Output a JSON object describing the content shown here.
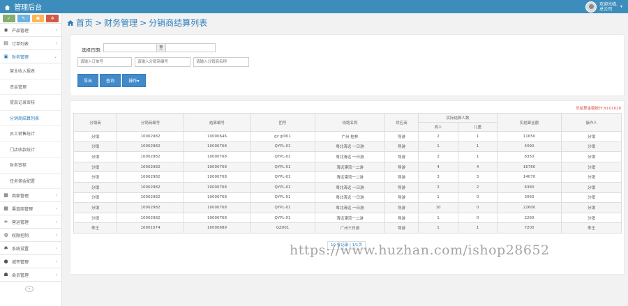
{
  "app": {
    "title": "管理后台"
  },
  "user": {
    "line1": "欢迎光临,",
    "line2": "总公司",
    "caret": "▾"
  },
  "quick_buttons": [
    {
      "icon": "leaf-icon",
      "glyph": "✓"
    },
    {
      "icon": "pencil-icon",
      "glyph": "✎"
    },
    {
      "icon": "users-icon",
      "glyph": "☗"
    },
    {
      "icon": "cogs-icon",
      "glyph": "✲"
    }
  ],
  "sidebar": {
    "top_items": [
      {
        "label": "产品管理",
        "icon": "product-icon",
        "glyph": "◉"
      },
      {
        "label": "订单列表",
        "icon": "order-icon",
        "glyph": "▤"
      },
      {
        "label": "财务管理",
        "icon": "finance-icon",
        "glyph": "▣"
      }
    ],
    "sub_items": [
      {
        "label": "营业收入报表"
      },
      {
        "label": "资金管理"
      },
      {
        "label": "提现记录审核"
      },
      {
        "label": "分销商结算列表"
      },
      {
        "label": "员工销售统计"
      },
      {
        "label": "门店收款统计"
      },
      {
        "label": "财务审核"
      },
      {
        "label": "任务佣金配置"
      }
    ],
    "bottom_items": [
      {
        "label": "商家管理",
        "icon": "store-icon",
        "glyph": "▦"
      },
      {
        "label": "渠道商管理",
        "icon": "channel-icon",
        "glyph": "▦"
      },
      {
        "label": "营运管理",
        "icon": "sliders-icon",
        "glyph": "≑"
      },
      {
        "label": "权限控制",
        "icon": "lock-icon",
        "glyph": "◍"
      },
      {
        "label": "系统设置",
        "icon": "gear-icon",
        "glyph": "✱"
      },
      {
        "label": "城市管理",
        "icon": "map-marker-icon",
        "glyph": "●"
      },
      {
        "label": "会员管理",
        "icon": "members-icon",
        "glyph": "☗"
      }
    ],
    "chevron": "›",
    "chevron_open": "⌄",
    "collapse": "«"
  },
  "breadcrumb": {
    "home": "首页",
    "section": "财务管理",
    "current": "分销商结算列表",
    "sep": ">"
  },
  "filters": {
    "date_label": "选择日期:",
    "date_to": "至",
    "order_placeholder": "请输入订单号",
    "distributor_no_placeholder": "请输入分销商编号",
    "distributor_name_placeholder": "请输入分销商名称",
    "buttons": {
      "export": "导出",
      "search": "查询",
      "more": "操作▾"
    }
  },
  "summary": {
    "label": "总结算金额统计:",
    "value": "¥101628"
  },
  "table": {
    "headers": {
      "distributor": "分销商",
      "distributor_no": "分销商编号",
      "order_no": "结算编号",
      "route_no": "团号",
      "route_name": "线路名称",
      "supplier": "供应商",
      "people": "实际结算人数",
      "adult": "成人",
      "child": "儿童",
      "amount": "实结算金额",
      "operator": "操作人"
    },
    "rows": [
      [
        "分销",
        "10002982",
        "10000646",
        "gz gl001",
        "广州 桂林",
        "导游",
        "2",
        "1",
        "11650",
        "分销"
      ],
      [
        "分销",
        "10002982",
        "10000768",
        "QYPL-01",
        "粤北清远 一日游",
        "导游",
        "1",
        "1",
        "4090",
        "分销"
      ],
      [
        "分销",
        "10002982",
        "10000768",
        "QYPL-01",
        "粤北清远 一日游",
        "导游",
        "2",
        "1",
        "6350",
        "分销"
      ],
      [
        "分销",
        "10002982",
        "10000768",
        "QYPL-01",
        "清远漂流一二游",
        "导游",
        "4",
        "4",
        "16760",
        "分销"
      ],
      [
        "分销",
        "10002982",
        "10000768",
        "QYPL-01",
        "清远漂流一二游",
        "导游",
        "3",
        "3",
        "14070",
        "分销"
      ],
      [
        "分销",
        "10002982",
        "10000768",
        "QYPL-01",
        "粤北清远 一日游",
        "导游",
        "2",
        "2",
        "6380",
        "分销"
      ],
      [
        "分销",
        "10002982",
        "10000768",
        "QYPL-01",
        "粤北清远 一日游",
        "导游",
        "1",
        "0",
        "3060",
        "分销"
      ],
      [
        "分销",
        "10002982",
        "10000768",
        "QYPL-01",
        "粤北清远 一日游",
        "导游",
        "10",
        "0",
        "22600",
        "分销"
      ],
      [
        "分销",
        "10002982",
        "10000768",
        "QYPL-01",
        "清远漂流一二游",
        "导游",
        "1",
        "0",
        "2260",
        "分销"
      ],
      [
        "李王",
        "10001074",
        "10000689",
        "GZ001",
        "广州三日游",
        "导游",
        "1",
        "1",
        "7200",
        "李王"
      ]
    ]
  },
  "pager": {
    "text": "10 条记录 | 1/1页"
  },
  "watermark": "https://www.huzhan.com/ishop28652"
}
